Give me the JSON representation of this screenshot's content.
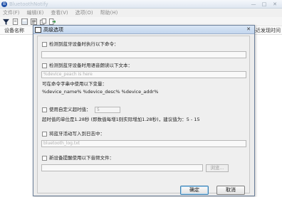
{
  "main": {
    "title": "BluetoothNotify",
    "icon_glyph": "B",
    "minimize": "—",
    "maximize": "□",
    "close": "✕"
  },
  "menubar": {
    "items": [
      "文件(F)",
      "编辑(E)",
      "查看(V)",
      "选项(O)",
      "帮助(H)"
    ]
  },
  "list": {
    "columns": [
      "设备名称",
      "最近发现时间"
    ]
  },
  "dialog": {
    "title": "高级选项",
    "close_glyph": "✕",
    "opt1_label": "检测到蓝牙设备时执行以下命令：",
    "opt1_value": "",
    "opt2_label": "检测到蓝牙设备时用语音朗读以下文本：",
    "opt2_value": "%device_peach is here",
    "vars_line1": "可在命令字串中使用以下变量：",
    "vars_line2": "%device_name% %device_desc% %device_addr%",
    "timeout_label": "使用自定义超时值：",
    "timeout_value": "5",
    "timeout_note": "超时值的单位是1.28秒 (即数值每增1则实际增加1.28秒)，建议值为：5 - 15",
    "log_label": "将蓝牙活动写入到日志中：",
    "log_value": "bluetooth_log.txt",
    "sound_label": "新设备提醒使用以下音频文件：",
    "sound_value": "",
    "browse_label": "浏览...",
    "ok_label": "确定",
    "cancel_label": "取消"
  },
  "colors": {
    "titlebar_accent": "#c3d6ee",
    "dialog_bg": "#ececec",
    "ok_border": "#3c7fb1"
  }
}
